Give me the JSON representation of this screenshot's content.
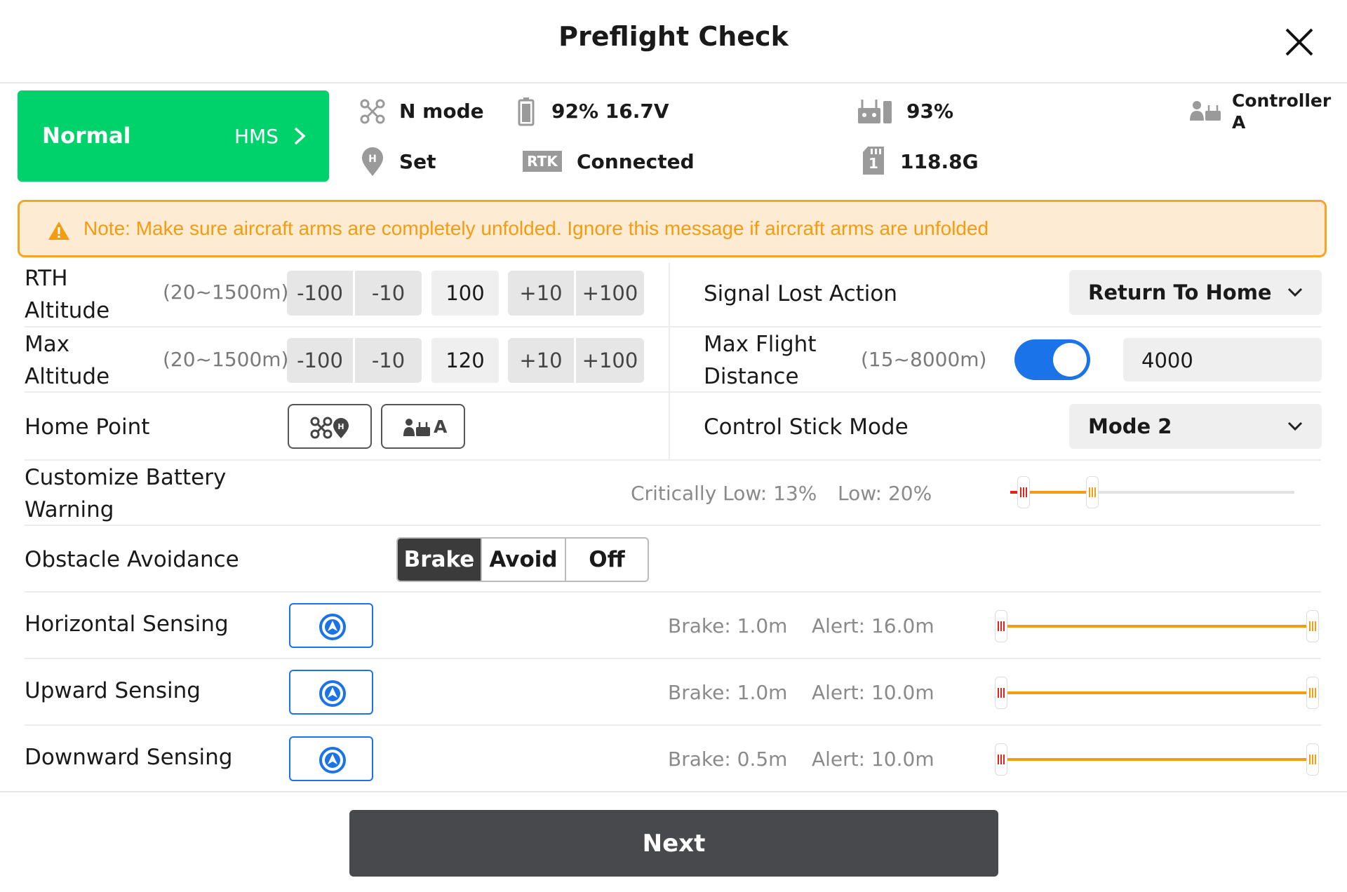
{
  "header": {
    "title": "Preflight Check"
  },
  "status": {
    "state": "Normal",
    "hms_label": "HMS"
  },
  "info": {
    "mode": "N mode",
    "battery": "92%  16.7V",
    "rc_battery": "93%",
    "controller": "Controller\nA",
    "home": "Set",
    "rtk_badge": "RTK",
    "rtk_status": "Connected",
    "storage": "118.8G",
    "storage_slot": "1"
  },
  "note": {
    "text": "Note: Make sure aircraft arms are completely unfolded. Ignore this message if aircraft arms are unfolded"
  },
  "rth_altitude": {
    "label_line1": "RTH",
    "label_line2": "Altitude",
    "range": "(20~1500m)",
    "steps": [
      "-100",
      "-10",
      "+10",
      "+100"
    ],
    "value": "100"
  },
  "max_altitude": {
    "label_line1": "Max",
    "label_line2": "Altitude",
    "range": "(20~1500m)",
    "steps": [
      "-100",
      "-10",
      "+10",
      "+100"
    ],
    "value": "120"
  },
  "signal_lost": {
    "label": "Signal Lost Action",
    "value": "Return To Home"
  },
  "max_distance": {
    "label_line1": "Max Flight",
    "label_line2": "Distance",
    "range": "(15~8000m)",
    "enabled": true,
    "value": "4000"
  },
  "home_point": {
    "label": "Home Point",
    "btn2_letter": "A"
  },
  "stick_mode": {
    "label": "Control Stick Mode",
    "value": "Mode 2"
  },
  "battery_warning": {
    "label_line1": "Customize Battery",
    "label_line2": "Warning",
    "critical": "Critically Low: 13%",
    "low": "Low: 20%",
    "critical_pct": 13,
    "low_pct": 20
  },
  "obstacle": {
    "label": "Obstacle Avoidance",
    "options": [
      "Brake",
      "Avoid",
      "Off"
    ],
    "selected": "Brake"
  },
  "sensing": [
    {
      "label": "Horizontal Sensing",
      "brake": "Brake: 1.0m",
      "alert": "Alert: 16.0m"
    },
    {
      "label": "Upward Sensing",
      "brake": "Brake: 1.0m",
      "alert": "Alert: 10.0m"
    },
    {
      "label": "Downward Sensing",
      "brake": "Brake: 0.5m",
      "alert": "Alert: 10.0m"
    }
  ],
  "footer": {
    "next_label": "Next"
  },
  "colors": {
    "accent_green": "#00d26b",
    "warning_orange": "#f39c12",
    "blue": "#1a73e8",
    "dark_button": "#47494c"
  }
}
